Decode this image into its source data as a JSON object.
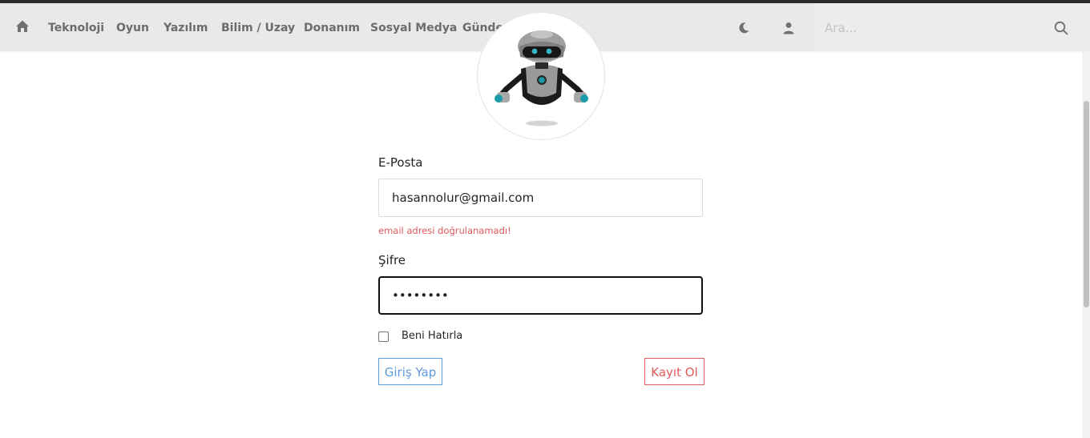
{
  "nav": {
    "items": [
      {
        "label": "Teknoloji"
      },
      {
        "label": "Oyun"
      },
      {
        "label": "Yazılım"
      },
      {
        "label": "Bilim / Uzay"
      },
      {
        "label": "Donanım"
      },
      {
        "label": "Sosyal Medya"
      },
      {
        "label": "Gündem"
      }
    ],
    "search_placeholder": "Ara..."
  },
  "form": {
    "email_label": "E-Posta",
    "email_value": "hasannolur@gmail.com",
    "email_error": "email adresi doğrulanamadı!",
    "password_label": "Şifre",
    "password_value": "••••••••",
    "remember_label": "Beni Hatırla",
    "login_button": "Giriş Yap",
    "register_button": "Kayıt Ol"
  },
  "colors": {
    "navbar_bg": "#e9e9e9",
    "login_accent": "#5e9be0",
    "register_accent": "#e05a5a",
    "error": "#e05a5a"
  },
  "icons": [
    "home-icon",
    "moon-icon",
    "user-icon",
    "search-icon",
    "robot-avatar"
  ]
}
